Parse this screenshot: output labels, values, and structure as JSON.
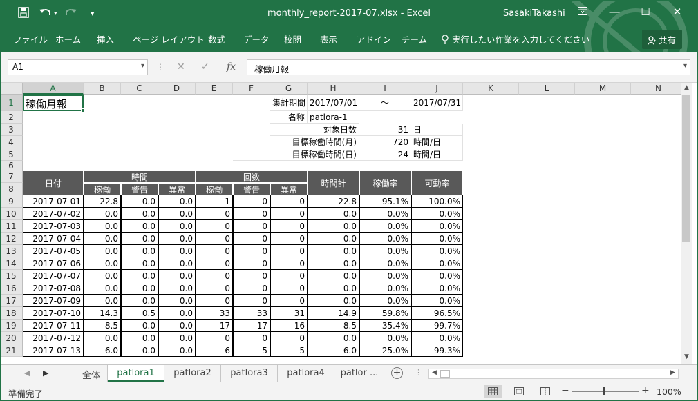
{
  "titlebar": {
    "save_icon": "save-icon",
    "undo_icon": "undo-icon",
    "redo_icon": "redo-icon",
    "customize_icon": "customize-qat-icon",
    "filename": "monthly_report-2017-07.xlsx - Excel",
    "user": "SasakiTakashi",
    "ribbon_display_icon": "ribbon-display-icon",
    "minimize": "―",
    "maximize": "☐",
    "close": "✕"
  },
  "ribbon": {
    "tabs": [
      "ファイル",
      "ホーム",
      "挿入",
      "ページ レイアウト",
      "数式",
      "データ",
      "校閲",
      "表示",
      "アドイン",
      "チーム"
    ],
    "tell_me": "実行したい作業を入力してください",
    "share": "共有"
  },
  "formula_bar": {
    "name_box": "A1",
    "cancel": "✕",
    "enter": "✓",
    "fx": "fx",
    "content": "稼働月報"
  },
  "columns": [
    "A",
    "B",
    "C",
    "D",
    "E",
    "F",
    "G",
    "H",
    "I",
    "J",
    "K",
    "L",
    "M",
    "N"
  ],
  "rows": [
    "1",
    "2",
    "3",
    "4",
    "5",
    "6",
    "7",
    "8",
    "9",
    "10",
    "11",
    "12",
    "13",
    "14",
    "15",
    "16",
    "17",
    "18",
    "19",
    "20",
    "21"
  ],
  "sheet": {
    "title": "稼働月報",
    "period_label": "集計期間",
    "period_start": "2017/07/01",
    "period_tilde": "～",
    "period_end": "2017/07/31",
    "name_label": "名称",
    "name_value": "patlora-1",
    "days_label": "対象日数",
    "days_value": "31",
    "days_unit": "日",
    "monthly_target_label": "目標稼働時間(月)",
    "monthly_target_value": "720",
    "monthly_target_unit": "時間/日",
    "daily_target_label": "目標稼働時間(日)",
    "daily_target_value": "24",
    "daily_target_unit": "時間/日",
    "header": {
      "date": "日付",
      "time_group": "時間",
      "count_group": "回数",
      "total_time": "時間計",
      "operation_rate": "稼働率",
      "availability": "可動率",
      "sub": [
        "稼働",
        "警告",
        "異常",
        "稼働",
        "警告",
        "異常"
      ]
    },
    "data_rows": [
      [
        "2017-07-01",
        "22.8",
        "0.0",
        "0.0",
        "1",
        "0",
        "0",
        "22.8",
        "95.1%",
        "100.0%"
      ],
      [
        "2017-07-02",
        "0.0",
        "0.0",
        "0.0",
        "0",
        "0",
        "0",
        "0.0",
        "0.0%",
        "0.0%"
      ],
      [
        "2017-07-03",
        "0.0",
        "0.0",
        "0.0",
        "0",
        "0",
        "0",
        "0.0",
        "0.0%",
        "0.0%"
      ],
      [
        "2017-07-04",
        "0.0",
        "0.0",
        "0.0",
        "0",
        "0",
        "0",
        "0.0",
        "0.0%",
        "0.0%"
      ],
      [
        "2017-07-05",
        "0.0",
        "0.0",
        "0.0",
        "0",
        "0",
        "0",
        "0.0",
        "0.0%",
        "0.0%"
      ],
      [
        "2017-07-06",
        "0.0",
        "0.0",
        "0.0",
        "0",
        "0",
        "0",
        "0.0",
        "0.0%",
        "0.0%"
      ],
      [
        "2017-07-07",
        "0.0",
        "0.0",
        "0.0",
        "0",
        "0",
        "0",
        "0.0",
        "0.0%",
        "0.0%"
      ],
      [
        "2017-07-08",
        "0.0",
        "0.0",
        "0.0",
        "0",
        "0",
        "0",
        "0.0",
        "0.0%",
        "0.0%"
      ],
      [
        "2017-07-09",
        "0.0",
        "0.0",
        "0.0",
        "0",
        "0",
        "0",
        "0.0",
        "0.0%",
        "0.0%"
      ],
      [
        "2017-07-10",
        "14.3",
        "0.5",
        "0.0",
        "33",
        "33",
        "31",
        "14.9",
        "59.8%",
        "96.5%"
      ],
      [
        "2017-07-11",
        "8.5",
        "0.0",
        "0.0",
        "17",
        "17",
        "16",
        "8.5",
        "35.4%",
        "99.7%"
      ],
      [
        "2017-07-12",
        "0.0",
        "0.0",
        "0.0",
        "0",
        "0",
        "0",
        "0.0",
        "0.0%",
        "0.0%"
      ],
      [
        "2017-07-13",
        "6.0",
        "0.0",
        "0.0",
        "6",
        "5",
        "5",
        "6.0",
        "25.0%",
        "99.3%"
      ]
    ]
  },
  "sheet_tabs": [
    "全体",
    "patlora1",
    "patlora2",
    "patlora3",
    "patlora4",
    "patlor ..."
  ],
  "active_sheet": "patlora1",
  "status": {
    "ready": "準備完了",
    "zoom_out": "−",
    "zoom_in": "+",
    "zoom": "100%"
  },
  "colors": {
    "excel_green": "#217346",
    "header_dark": "#595959"
  }
}
